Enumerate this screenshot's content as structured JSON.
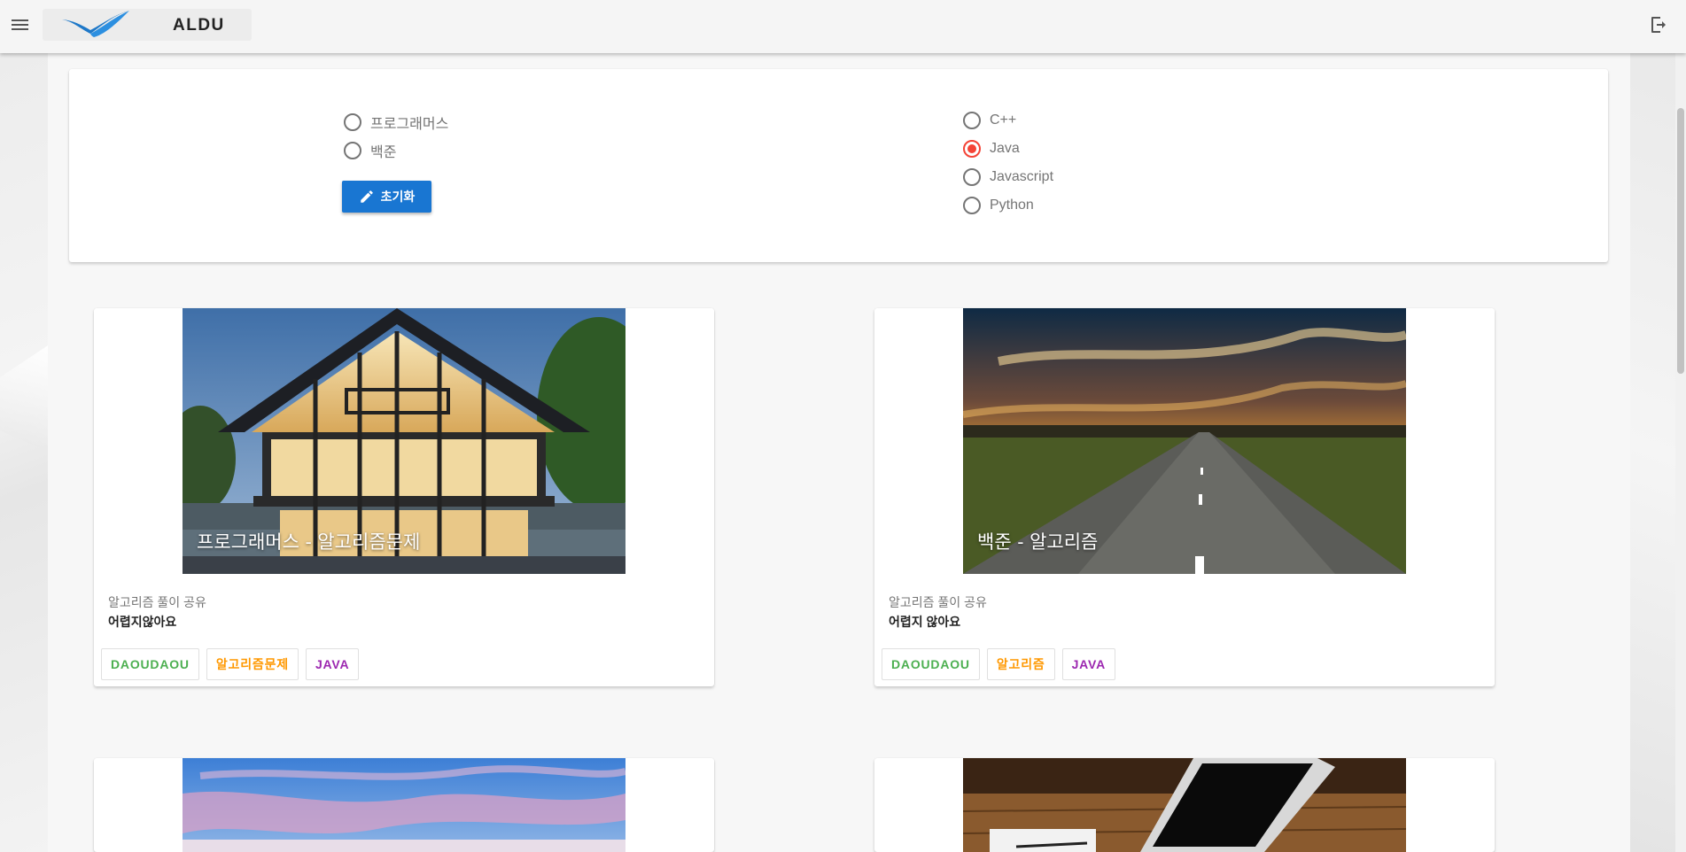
{
  "app": {
    "title": "ALDU"
  },
  "filters": {
    "sites": [
      {
        "label": "프로그래머스",
        "checked": false
      },
      {
        "label": "백준",
        "checked": false
      }
    ],
    "languages": [
      {
        "label": "C++",
        "checked": false
      },
      {
        "label": "Java",
        "checked": true
      },
      {
        "label": "Javascript",
        "checked": false
      },
      {
        "label": "Python",
        "checked": false
      }
    ],
    "reset_label": "초기화"
  },
  "cards": [
    {
      "title": "프로그래머스 - 알고리즘문제",
      "subtitle": "알고리즘 풀이 공유",
      "body": "어렵지않아요",
      "image": "house",
      "tags": [
        {
          "label": "DAOUDAOU",
          "color": "#4caf50"
        },
        {
          "label": "알고리즘문제",
          "color": "#ff9800"
        },
        {
          "label": "JAVA",
          "color": "#9c27b0"
        }
      ]
    },
    {
      "title": "백준 - 알고리즘",
      "subtitle": "알고리즘 풀이 공유",
      "body": "어렵지 않아요",
      "image": "road-sunset",
      "tags": [
        {
          "label": "DAOUDAOU",
          "color": "#4caf50"
        },
        {
          "label": "알고리즘",
          "color": "#ff9800"
        },
        {
          "label": "JAVA",
          "color": "#9c27b0"
        }
      ]
    },
    {
      "image": "sky"
    },
    {
      "image": "laptop"
    }
  ],
  "colors": {
    "primary": "#1976d2",
    "radio_checked": "#f44336"
  },
  "icons": [
    "menu-icon",
    "logo-icon",
    "logout-icon",
    "pencil-icon"
  ]
}
